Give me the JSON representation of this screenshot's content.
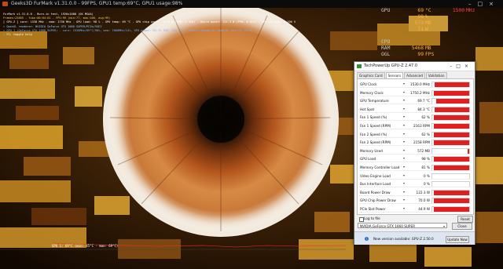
{
  "furmark": {
    "title": "Geeks3D FurMark v1.31.0.0 - 99FPS, GPU1 temp:69°C, GPU1 usage:98%",
    "overlay_lines": [
      "FurMark v1.31.0.0 - Burn-in test, 1920x1080 (0X MSAA)",
      "Frames:23865 - time:00:04:01 - FPS:99 (min:77, max:100, avg:99)",
      "[ GPU-Z ] core: 1530 MHz - mem: 1750 MHz - GPU load: 98 % - GPU temp: 69 °C - GPU chip power: 75.0 W (PPW: 1.320) - Board power: 122.3 W (PPW: 0.810) - GPU voltage: 0.706 V",
      "> OpenGL renderer: NVIDIA GeForce GTX 1660 SUPER/PCIe/SSE2",
      "> GPU 1 (GeForce GTX 1660 SUPER) - core: 1530MHz/69°C/98%, mem: 7000MHz/14%, GPU power: 93.7% TDP, fan: 62%, limits:[power:1, temp:0, volt:0, OV:0]",
      "- F1: toggle help"
    ],
    "temp_graph_label": "GPU 1: 69°C (min: 45°C - max: 69°C)"
  },
  "osd": {
    "rows": [
      {
        "label": "GPU",
        "v1": "69",
        "u1": "°C",
        "v2": "1500",
        "u2": "MHz"
      },
      {
        "label": "",
        "v1": "98",
        "u1": "%",
        "v2": "",
        "u2": ""
      },
      {
        "label": "",
        "v1": "573",
        "u1": "MB",
        "v2": "",
        "u2": ""
      },
      {
        "label": "",
        "v1": "71",
        "u1": "W",
        "v2": "",
        "u2": ""
      },
      {
        "label": "",
        "v1": "",
        "u1": "",
        "v2": "",
        "u2": ""
      },
      {
        "label": "CPU",
        "v1": "",
        "u1": "",
        "v2": "",
        "u2": ""
      },
      {
        "label": "RAM",
        "v1": "5468",
        "u1": "MB",
        "v2": "",
        "u2": ""
      },
      {
        "label": "OGL",
        "v1": "99",
        "u1": "FPS",
        "v2": "",
        "u2": ""
      }
    ]
  },
  "gpuz": {
    "title": "TechPowerUp GPU-Z 2.47.0",
    "tabs": [
      "Graphics Card",
      "Sensors",
      "Advanced",
      "Validation"
    ],
    "active_tab": "Sensors",
    "sensors": [
      {
        "name": "GPU Clock",
        "value": "1530.0 MHz",
        "level": 0.93
      },
      {
        "name": "Memory Clock",
        "value": "1750.2 MHz",
        "level": 0.96
      },
      {
        "name": "GPU Temperature",
        "value": "69.7 °C",
        "level": 0.9
      },
      {
        "name": "Hot Spot",
        "value": "84.3 °C",
        "level": 0.93
      },
      {
        "name": "Fan 1 Speed (%)",
        "value": "62 %",
        "level": 0.96
      },
      {
        "name": "Fan 1 Speed (RPM)",
        "value": "2163 RPM",
        "level": 0.96
      },
      {
        "name": "Fan 2 Speed (%)",
        "value": "62 %",
        "level": 0.96
      },
      {
        "name": "Fan 2 Speed (RPM)",
        "value": "2158 RPM",
        "level": 0.96
      },
      {
        "name": "Memory Used",
        "value": "572 MB",
        "level": 0.04
      },
      {
        "name": "GPU Load",
        "value": "98 %",
        "level": 0.96
      },
      {
        "name": "Memory Controller Load",
        "value": "81 %",
        "level": 0.96
      },
      {
        "name": "Video Engine Load",
        "value": "0 %",
        "level": 0
      },
      {
        "name": "Bus Interface Load",
        "value": "0 %",
        "level": 0
      },
      {
        "name": "Board Power Draw",
        "value": "122.3 W",
        "level": 0.96
      },
      {
        "name": "GPU Chip Power Draw",
        "value": "70.0 W",
        "level": 0.96
      },
      {
        "name": "PCIe Slot Power",
        "value": "44.9 W",
        "level": 0.96
      }
    ],
    "log_to_file_label": "Log to file",
    "reset_label": "Reset",
    "gpu_select": "NVIDIA GeForce GTX 1660 SUPER",
    "close_label": "Close",
    "update_message": "New version available: GPU-Z 2.50.0",
    "update_button": "Update Now",
    "colors": {
      "bar": "#e02020",
      "accent": "#2b6fc7"
    }
  }
}
